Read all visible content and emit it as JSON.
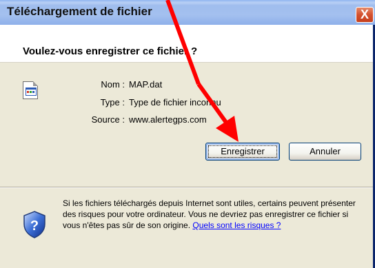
{
  "window": {
    "title": "Téléchargement de fichier",
    "close_symbol": "X"
  },
  "dialog": {
    "question": "Voulez-vous enregistrer ce fichier ?",
    "file_icon": "file-icon",
    "fields": [
      {
        "label": "Nom :",
        "value": "MAP.dat"
      },
      {
        "label": "Type :",
        "value": "Type de fichier inconnu"
      },
      {
        "label": "Source :",
        "value": "www.alertegps.com"
      }
    ]
  },
  "buttons": {
    "save_label": "Enregistrer",
    "cancel_label": "Annuler"
  },
  "warning": {
    "icon": "shield-question-icon",
    "text": "Si les fichiers téléchargés depuis Internet sont utiles, certains peuvent présenter des risques pour votre ordinateur. Vous ne devriez pas enregistrer ce fichier si vous n'êtes pas sûr de son origine. ",
    "link_text": "Quels sont les risques ?"
  },
  "annotation": {
    "arrow_color": "#ff0000"
  }
}
